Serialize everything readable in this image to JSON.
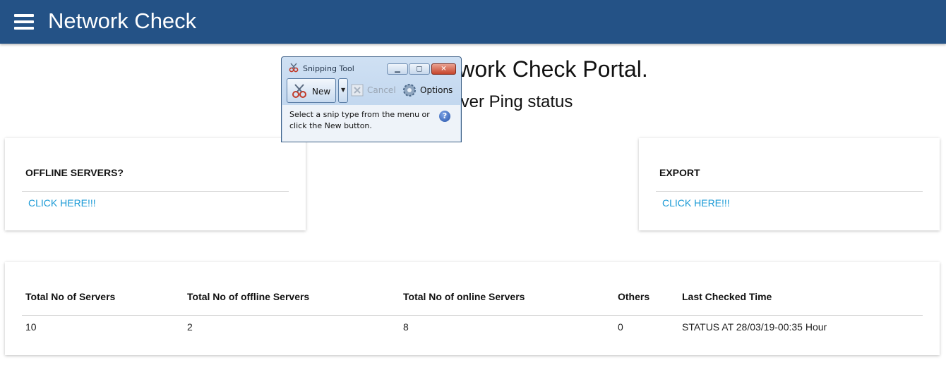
{
  "header": {
    "title": "Network Check",
    "menu_icon": "hamburger-menu-icon"
  },
  "hero": {
    "title": "Welcome to Network Check Portal.",
    "subtitle": "Monitor Server Ping status"
  },
  "cards": {
    "offline": {
      "title": "OFFLINE SERVERS?",
      "link": "CLICK HERE!!!"
    },
    "export": {
      "title": "EXPORT",
      "link": "CLICK HERE!!!"
    }
  },
  "summary_table": {
    "headers": [
      "Total No of Servers",
      "Total No of offline Servers",
      "Total No of online Servers",
      "Others",
      "Last Checked Time"
    ],
    "rows": [
      [
        "10",
        "2",
        "8",
        "0",
        "STATUS AT 28/03/19-00:35 Hour"
      ]
    ]
  },
  "snipping_tool": {
    "title": "Snipping Tool",
    "new_label": "New",
    "cancel_label": "Cancel",
    "options_label": "Options",
    "help_text": "Select a snip type from the menu or click the New button.",
    "help_icon": "?"
  },
  "colors": {
    "appbar": "#245286",
    "link": "#1a9ad6"
  }
}
